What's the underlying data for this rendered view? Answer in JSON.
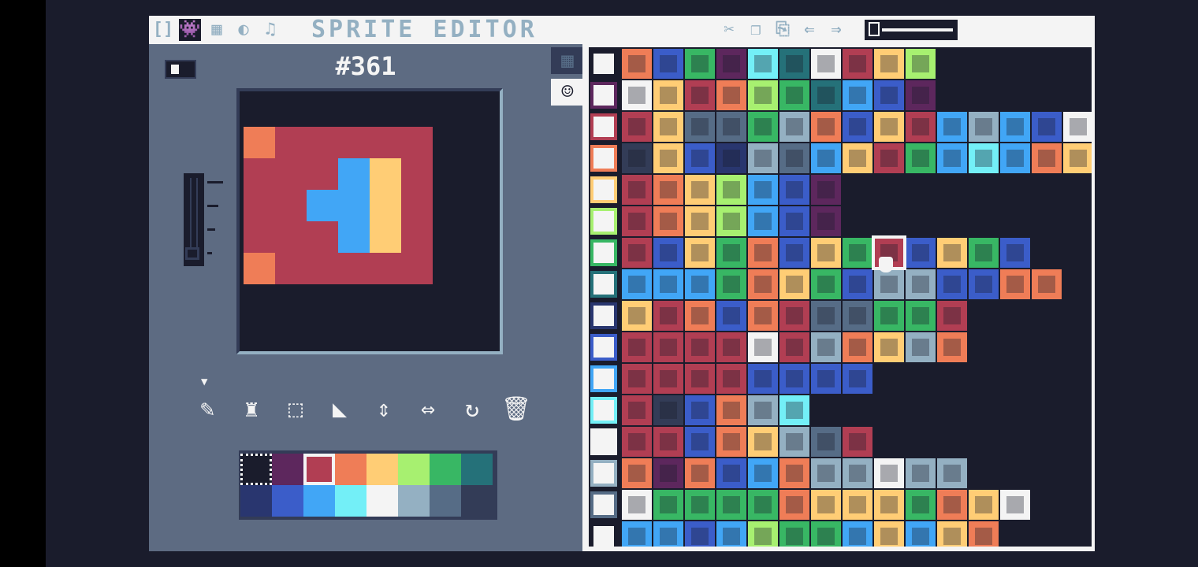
{
  "app": {
    "title": "SPRITE EDITOR",
    "sprite_id": "#361"
  },
  "topbar": {
    "left_icons": [
      {
        "name": "code-editor-icon",
        "glyph": "[]"
      },
      {
        "name": "sprite-editor-icon",
        "glyph": "👾",
        "active": true
      },
      {
        "name": "map-editor-icon",
        "glyph": "▦"
      },
      {
        "name": "sfx-editor-icon",
        "glyph": "◐"
      },
      {
        "name": "music-editor-icon",
        "glyph": "♫"
      }
    ],
    "right_icons": [
      {
        "name": "cut-icon",
        "glyph": "✂"
      },
      {
        "name": "copy-icon",
        "glyph": "❐"
      },
      {
        "name": "paste-icon",
        "glyph": "⎘"
      },
      {
        "name": "undo-icon",
        "glyph": "⇐"
      },
      {
        "name": "redo-icon",
        "glyph": "⇒"
      }
    ]
  },
  "colors": {
    "bg": "#1a1c2c",
    "panel": "#5d6b82",
    "white": "#f4f4f4",
    "accent_red": "#b13e53"
  },
  "canvas": {
    "pixels": [
      {
        "c": "#ef7d57",
        "x": 0,
        "y": 0,
        "w": 1,
        "h": 1
      },
      {
        "c": "#b13e53",
        "x": 1,
        "y": 0,
        "w": 5,
        "h": 1
      },
      {
        "c": "#b13e53",
        "x": 0,
        "y": 1,
        "w": 6,
        "h": 1
      },
      {
        "c": "#b13e53",
        "x": 0,
        "y": 2,
        "w": 3,
        "h": 1
      },
      {
        "c": "#41a6f6",
        "x": 3,
        "y": 1,
        "w": 1,
        "h": 3
      },
      {
        "c": "#ffcd75",
        "x": 4,
        "y": 1,
        "w": 1,
        "h": 3
      },
      {
        "c": "#b13e53",
        "x": 5,
        "y": 1,
        "w": 1,
        "h": 3
      },
      {
        "c": "#41a6f6",
        "x": 2,
        "y": 2,
        "w": 1,
        "h": 1
      },
      {
        "c": "#b13e53",
        "x": 0,
        "y": 3,
        "w": 3,
        "h": 1
      },
      {
        "c": "#b13e53",
        "x": 0,
        "y": 2,
        "w": 2,
        "h": 1
      },
      {
        "c": "#ef7d57",
        "x": 0,
        "y": 4,
        "w": 1,
        "h": 1
      },
      {
        "c": "#b13e53",
        "x": 1,
        "y": 4,
        "w": 5,
        "h": 1
      }
    ]
  },
  "brush": {
    "size_level": 1,
    "max": 4
  },
  "tools": [
    {
      "name": "pencil-icon",
      "glyph": "✎",
      "selected": true
    },
    {
      "name": "stamp-icon",
      "glyph": "♜"
    },
    {
      "name": "select-icon",
      "glyph": "⬚"
    },
    {
      "name": "fill-icon",
      "glyph": "◣"
    },
    {
      "name": "flip-vertical-icon",
      "glyph": "⇕"
    },
    {
      "name": "flip-horizontal-icon",
      "glyph": "⇔"
    },
    {
      "name": "rotate-icon",
      "glyph": "↻"
    },
    {
      "name": "delete-icon",
      "glyph": "🗑"
    }
  ],
  "palette": {
    "selected_index": 2,
    "colors": [
      "#1a1c2c",
      "#5d275d",
      "#b13e53",
      "#ef7d57",
      "#ffcd75",
      "#a7f070",
      "#38b764",
      "#257179",
      "#29366f",
      "#3b5dc9",
      "#41a6f6",
      "#73eff7",
      "#f4f4f4",
      "#94b0c2",
      "#566c86",
      "#333c57"
    ]
  },
  "sheet": {
    "selected_col": 8,
    "selected_row": 6,
    "row_marker_colors": [
      "#1a1c2c",
      "#5d275d",
      "#b13e53",
      "#ef7d57",
      "#ffcd75",
      "#a7f070",
      "#38b764",
      "#257179",
      "#29366f",
      "#3b5dc9",
      "#41a6f6",
      "#73eff7",
      "#f4f4f4",
      "#94b0c2",
      "#566c86",
      "#1a1c2c"
    ],
    "rows": [
      [
        "#ef7d57",
        "#3b5dc9",
        "#38b764",
        "#5d275d",
        "#73eff7",
        "#257179",
        "#f4f4f4",
        "#b13e53",
        "#ffcd75",
        "#a7f070"
      ],
      [
        "#f4f4f4",
        "#ffcd75",
        "#b13e53",
        "#ef7d57",
        "#a7f070",
        "#38b764",
        "#257179",
        "#41a6f6",
        "#3b5dc9",
        "#5d275d"
      ],
      [
        "#b13e53",
        "#ffcd75",
        "#566c86",
        "#566c86",
        "#38b764",
        "#94b0c2",
        "#ef7d57",
        "#3b5dc9",
        "#ffcd75",
        "#b13e53",
        "#41a6f6",
        "#94b0c2",
        "#41a6f6",
        "#3b5dc9",
        "#f4f4f4"
      ],
      [
        "#333c57",
        "#ffcd75",
        "#3b5dc9",
        "#29366f",
        "#94b0c2",
        "#566c86",
        "#41a6f6",
        "#ffcd75",
        "#b13e53",
        "#38b764",
        "#41a6f6",
        "#73eff7",
        "#41a6f6",
        "#ef7d57",
        "#ffcd75"
      ],
      [
        "#b13e53",
        "#ef7d57",
        "#ffcd75",
        "#a7f070",
        "#41a6f6",
        "#3b5dc9",
        "#5d275d"
      ],
      [
        "#b13e53",
        "#ef7d57",
        "#ffcd75",
        "#a7f070",
        "#41a6f6",
        "#3b5dc9",
        "#5d275d"
      ],
      [
        "#b13e53",
        "#3b5dc9",
        "#ffcd75",
        "#38b764",
        "#ef7d57",
        "#3b5dc9",
        "#ffcd75",
        "#38b764",
        "#b13e53",
        "#3b5dc9",
        "#ffcd75",
        "#38b764",
        "#3b5dc9"
      ],
      [
        "#41a6f6",
        "#41a6f6",
        "#41a6f6",
        "#38b764",
        "#ef7d57",
        "#ffcd75",
        "#38b764",
        "#3b5dc9",
        "#94b0c2",
        "#94b0c2",
        "#3b5dc9",
        "#3b5dc9",
        "#ef7d57",
        "#ef7d57"
      ],
      [
        "#ffcd75",
        "#b13e53",
        "#ef7d57",
        "#3b5dc9",
        "#ef7d57",
        "#b13e53",
        "#566c86",
        "#566c86",
        "#38b764",
        "#38b764",
        "#b13e53"
      ],
      [
        "#b13e53",
        "#b13e53",
        "#b13e53",
        "#b13e53",
        "#f4f4f4",
        "#b13e53",
        "#94b0c2",
        "#ef7d57",
        "#ffcd75",
        "#94b0c2",
        "#ef7d57"
      ],
      [
        "#b13e53",
        "#b13e53",
        "#b13e53",
        "#b13e53",
        "#3b5dc9",
        "#3b5dc9",
        "#3b5dc9",
        "#3b5dc9"
      ],
      [
        "#b13e53",
        "#333c57",
        "#3b5dc9",
        "#ef7d57",
        "#94b0c2",
        "#73eff7"
      ],
      [
        "#b13e53",
        "#b13e53",
        "#3b5dc9",
        "#ef7d57",
        "#ffcd75",
        "#94b0c2",
        "#566c86",
        "#b13e53"
      ],
      [
        "#ef7d57",
        "#5d275d",
        "#ef7d57",
        "#3b5dc9",
        "#41a6f6",
        "#ef7d57",
        "#94b0c2",
        "#94b0c2",
        "#f4f4f4",
        "#94b0c2",
        "#94b0c2"
      ],
      [
        "#f4f4f4",
        "#38b764",
        "#38b764",
        "#38b764",
        "#38b764",
        "#ef7d57",
        "#ffcd75",
        "#ffcd75",
        "#ffcd75",
        "#38b764",
        "#ef7d57",
        "#ffcd75",
        "#f4f4f4"
      ],
      [
        "#41a6f6",
        "#41a6f6",
        "#3b5dc9",
        "#41a6f6",
        "#a7f070",
        "#38b764",
        "#38b764",
        "#41a6f6",
        "#ffcd75",
        "#41a6f6",
        "#ffcd75",
        "#ef7d57"
      ]
    ]
  }
}
